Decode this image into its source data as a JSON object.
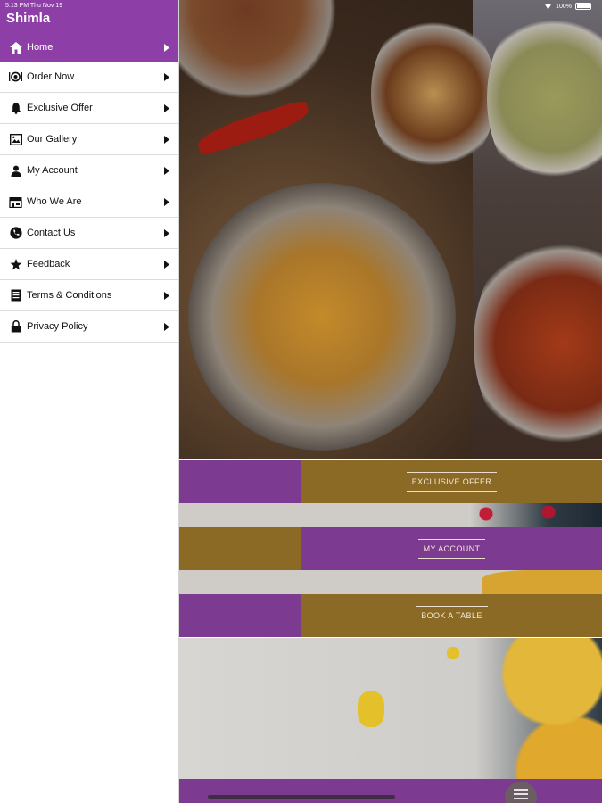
{
  "status_bar": {
    "time_date": "5:13 PM  Thu Nov 19",
    "battery": "100%"
  },
  "app": {
    "title": "Shimla"
  },
  "drawer": {
    "items": [
      {
        "label": "Home",
        "icon": "home-icon",
        "active": true
      },
      {
        "label": "Order Now",
        "icon": "dish-icon",
        "active": false
      },
      {
        "label": "Exclusive Offer",
        "icon": "bell-icon",
        "active": false
      },
      {
        "label": "Our Gallery",
        "icon": "gallery-icon",
        "active": false
      },
      {
        "label": "My Account",
        "icon": "person-icon",
        "active": false
      },
      {
        "label": "Who We Are",
        "icon": "store-icon",
        "active": false
      },
      {
        "label": "Contact Us",
        "icon": "phone-icon",
        "active": false
      },
      {
        "label": "Feedback",
        "icon": "star-icon",
        "active": false
      },
      {
        "label": "Terms & Conditions",
        "icon": "document-icon",
        "active": false
      },
      {
        "label": "Privacy Policy",
        "icon": "lock-icon",
        "active": false
      }
    ]
  },
  "main": {
    "buttons": [
      {
        "label": "EXCLUSIVE OFFER"
      },
      {
        "label": "MY ACCOUNT"
      },
      {
        "label": "BOOK A TABLE"
      }
    ],
    "menu_button_icon": "hamburger-icon"
  },
  "colors": {
    "purple": "#8d3fa7",
    "band_purple": "#7c3a91",
    "gold": "#8b6a25"
  }
}
